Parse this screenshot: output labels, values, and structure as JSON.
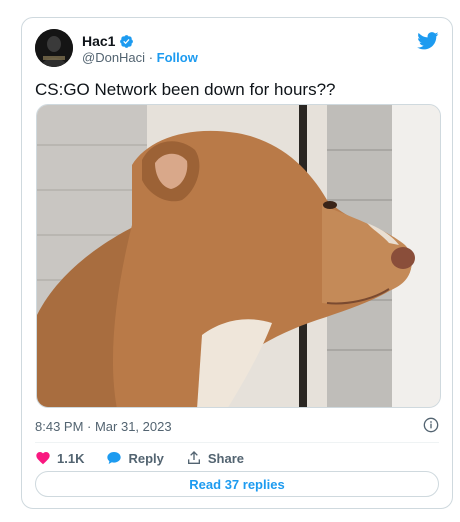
{
  "tweet": {
    "author_name": "Hac1",
    "author_handle": "@DonHaci",
    "separator": "·",
    "follow_label": "Follow",
    "text": "CS:GO Network been down for hours??",
    "timestamp": "8:43 PM · Mar 31, 2023"
  },
  "actions": {
    "like_count": "1.1K",
    "reply_label": "Reply",
    "share_label": "Share"
  },
  "read_replies_label": "Read 37 replies",
  "colors": {
    "accent": "#1d9bf0",
    "like": "#f91880",
    "secondary_text": "#536471",
    "border": "#cfd9de"
  },
  "icons": {
    "verified": "verified-badge-icon",
    "brand": "twitter-bird-icon",
    "like": "heart-icon",
    "reply": "reply-bubble-icon",
    "share": "share-upload-icon",
    "info": "info-icon"
  }
}
